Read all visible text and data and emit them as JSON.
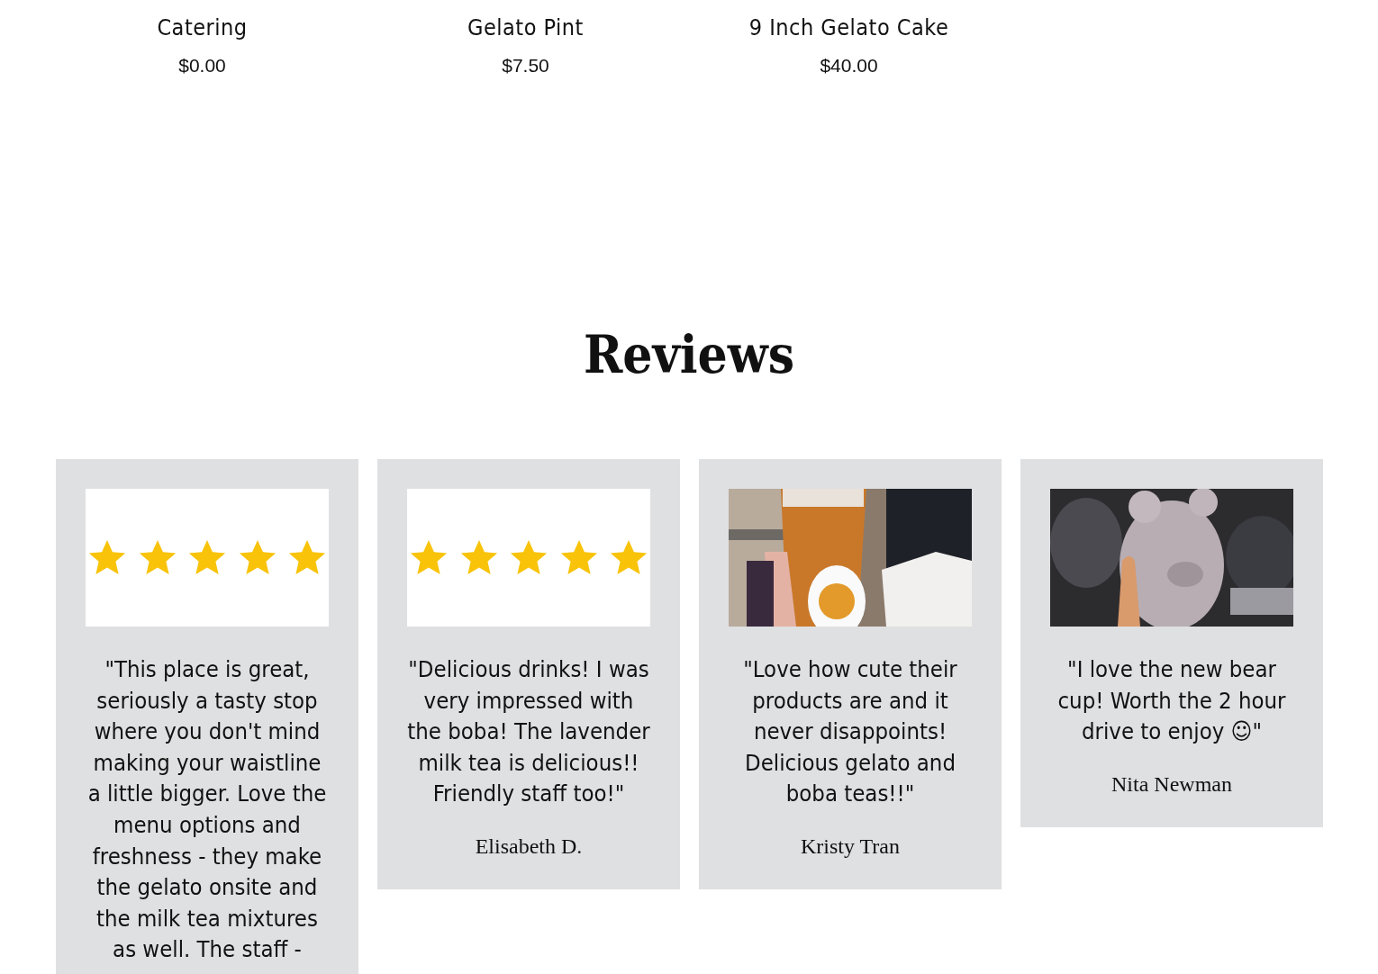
{
  "products": [
    {
      "name": "Catering",
      "price": "$0.00"
    },
    {
      "name": "Gelato Pint",
      "price": "$7.50"
    },
    {
      "name": "9 Inch Gelato Cake",
      "price": "$40.00"
    }
  ],
  "reviews": {
    "title": "Reviews",
    "items": [
      {
        "media": {
          "kind": "stars",
          "stars": 5
        },
        "quote": "\"This place is great, seriously a tasty stop where you don't mind making your waistline a little bigger. Love the menu options and freshness - they make the gelato onsite and the milk tea mixtures as well. The staff -"
      },
      {
        "media": {
          "kind": "stars",
          "stars": 5
        },
        "quote": "\"Delicious drinks! I was very impressed with the boba! The lavender milk tea is delicious!! Friendly staff too!\"",
        "author": "Elisabeth D."
      },
      {
        "quote": "\"Love how cute their products are and it never disappoints! Delicious gelato and boba teas!!\"",
        "author": "Kristy Tran"
      },
      {
        "quote": "\"I love the new bear cup! Worth the 2 hour drive to enjoy ☺\"",
        "author": "Nita Newman"
      }
    ]
  }
}
